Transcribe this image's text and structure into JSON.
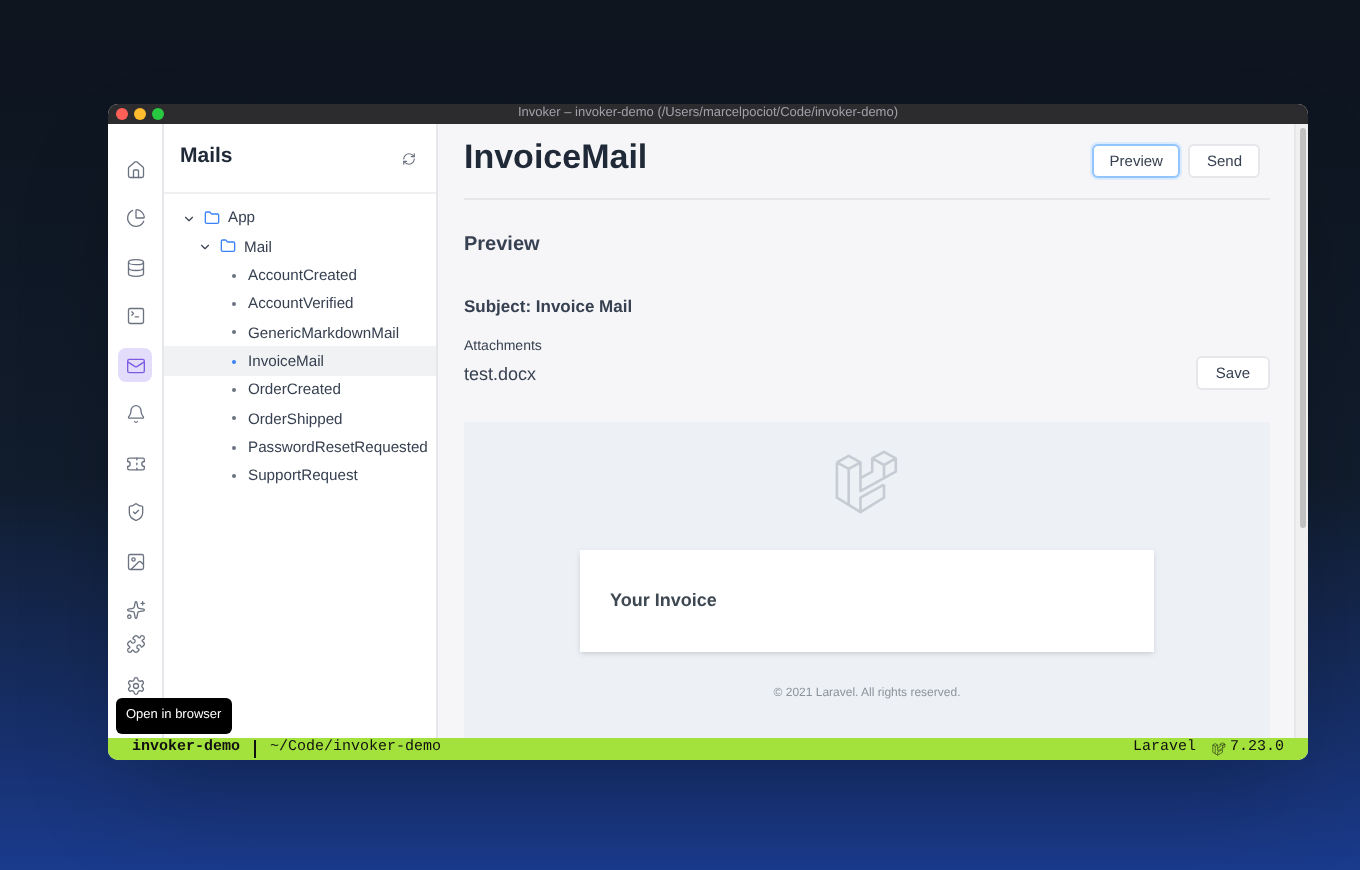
{
  "window": {
    "title": "Invoker – invoker-demo (/Users/marcelpociot/Code/invoker-demo)"
  },
  "rail": [
    {
      "selected": false
    },
    {
      "selected": false
    },
    {
      "selected": false
    },
    {
      "selected": false
    },
    {
      "selected": true
    },
    {
      "selected": false
    },
    {
      "selected": false
    },
    {
      "selected": false
    },
    {
      "selected": false
    },
    {
      "selected": false
    }
  ],
  "rail_bottom": [
    {
      "selected": false
    },
    {
      "selected": false
    }
  ],
  "tree_panel": {
    "title": "Mails",
    "tree": [
      {
        "label": "App",
        "expanded": true,
        "children": [
          {
            "label": "Mail",
            "expanded": true,
            "children": [
              {
                "label": "AccountCreated",
                "selected": false
              },
              {
                "label": "AccountVerified",
                "selected": false
              },
              {
                "label": "GenericMarkdownMail",
                "selected": false
              },
              {
                "label": "InvoiceMail",
                "selected": true
              },
              {
                "label": "OrderCreated",
                "selected": false
              },
              {
                "label": "OrderShipped",
                "selected": false
              },
              {
                "label": "PasswordResetRequested",
                "selected": false
              },
              {
                "label": "SupportRequest",
                "selected": false
              }
            ]
          }
        ]
      }
    ]
  },
  "content": {
    "title": "InvoiceMail",
    "buttons": [
      {
        "label": "Preview",
        "selected": true
      },
      {
        "label": "Send",
        "selected": false
      }
    ],
    "section": "Preview",
    "subject": "Subject: Invoice Mail",
    "attachments_label": "Attachments",
    "attachment": "test.docx",
    "save": "Save",
    "email": {
      "heading": "Your Invoice",
      "footer": "© 2021 Laravel. All rights reserved."
    }
  },
  "tooltip": "Open in browser",
  "status_bar": {
    "project": "invoker-demo",
    "path": "~/Code/invoker-demo",
    "framework": "Laravel",
    "version": "7.23.0"
  }
}
